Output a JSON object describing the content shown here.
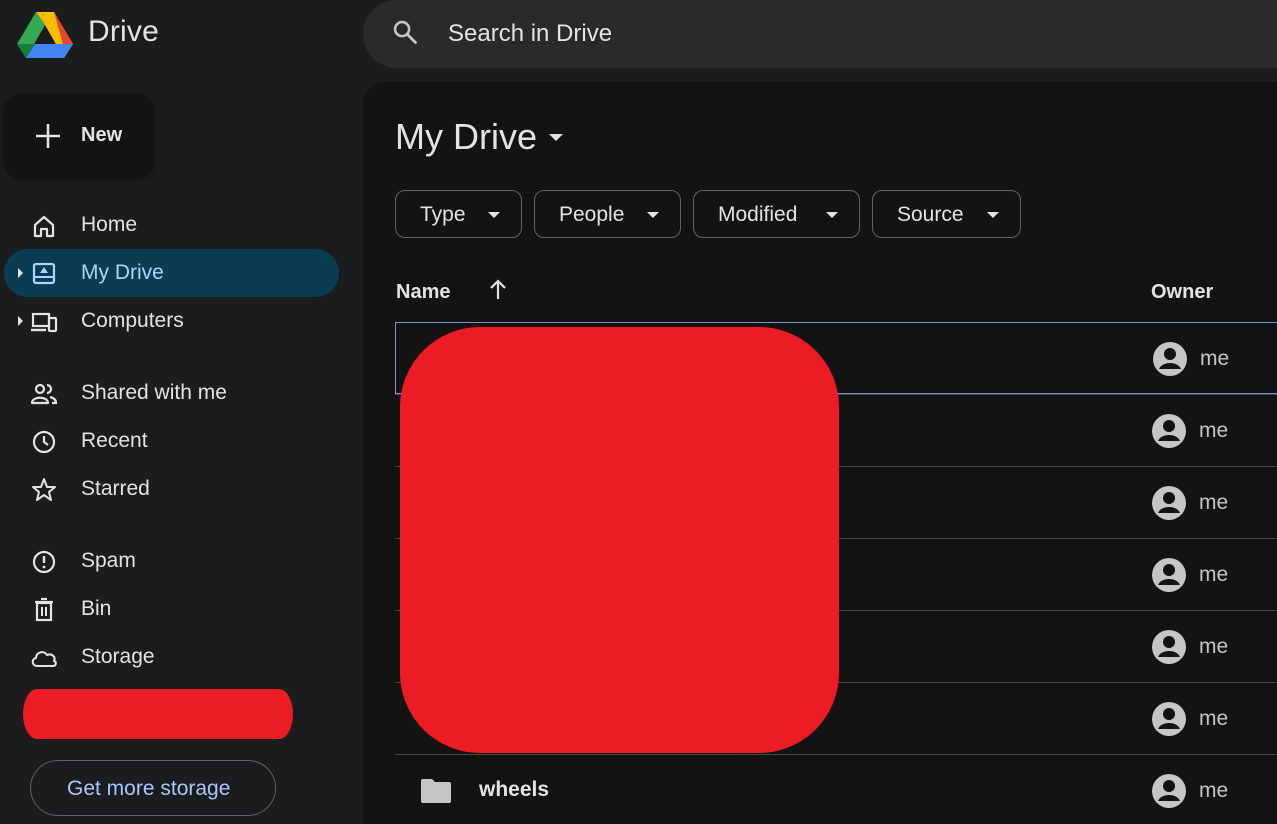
{
  "app": {
    "name": "Drive",
    "search_placeholder": "Search in Drive"
  },
  "sidebar": {
    "new_label": "New",
    "items": [
      {
        "label": "Home",
        "icon": "home-icon",
        "active": false
      },
      {
        "label": "My Drive",
        "icon": "my-drive-icon",
        "active": true
      },
      {
        "label": "Computers",
        "icon": "computers-icon",
        "active": false
      },
      {
        "label": "Shared with me",
        "icon": "people-icon",
        "active": false
      },
      {
        "label": "Recent",
        "icon": "clock-icon",
        "active": false
      },
      {
        "label": "Starred",
        "icon": "star-icon",
        "active": false
      },
      {
        "label": "Spam",
        "icon": "spam-icon",
        "active": false
      },
      {
        "label": "Bin",
        "icon": "trash-icon",
        "active": false
      },
      {
        "label": "Storage",
        "icon": "cloud-icon",
        "active": false
      }
    ],
    "storage_button": "Get more storage"
  },
  "main": {
    "title": "My Drive",
    "filters": [
      "Type",
      "People",
      "Modified",
      "Source"
    ],
    "columns": {
      "name": "Name",
      "owner": "Owner"
    },
    "rows": [
      {
        "name": "",
        "owner": "me"
      },
      {
        "name": "",
        "owner": "me"
      },
      {
        "name": "",
        "owner": "me"
      },
      {
        "name": "",
        "owner": "me"
      },
      {
        "name": "",
        "owner": "me"
      },
      {
        "name": "",
        "owner": "me"
      },
      {
        "name": "wheels",
        "owner": "me"
      }
    ]
  },
  "colors": {
    "background": "#1b1c1d",
    "panel": "#131314",
    "active_nav": "#0b3d52",
    "active_text": "#a8d4ff",
    "link": "#a8c7fa",
    "redaction": "#ec1c24"
  }
}
